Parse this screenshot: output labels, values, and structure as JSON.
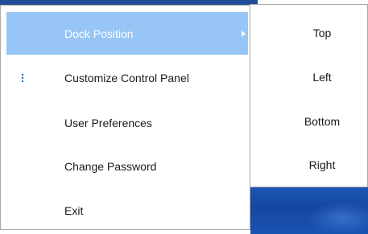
{
  "menu": {
    "items": [
      {
        "label": "Dock Position",
        "icon": "",
        "has_submenu": true,
        "highlighted": true
      },
      {
        "label": "Customize Control Panel",
        "icon": "vertical-ellipsis-icon",
        "has_submenu": false,
        "highlighted": false
      },
      {
        "label": "User Preferences",
        "icon": "",
        "has_submenu": false,
        "highlighted": false
      },
      {
        "label": "Change Password",
        "icon": "",
        "has_submenu": false,
        "highlighted": false
      },
      {
        "label": "Exit",
        "icon": "",
        "has_submenu": false,
        "highlighted": false
      }
    ]
  },
  "submenu": {
    "items": [
      {
        "label": "Top"
      },
      {
        "label": "Left"
      },
      {
        "label": "Bottom"
      },
      {
        "label": "Right"
      }
    ]
  },
  "colors": {
    "highlight": "#97c5f5",
    "desktop": "#1b56b4",
    "icon": "#1f66c8"
  }
}
